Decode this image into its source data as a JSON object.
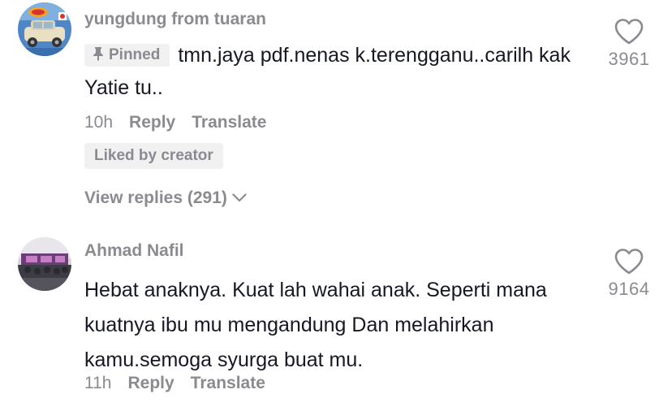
{
  "comments": [
    {
      "username": "yungdung from tuaran",
      "pinned_label": "Pinned",
      "text": "tmn.jaya pdf.nenas k.terengganu..carilh kak Yatie tu..",
      "time": "10h",
      "reply_label": "Reply",
      "translate_label": "Translate",
      "liked_by_creator_label": "Liked by creator",
      "view_replies_label": "View replies (291)",
      "like_count": "3961",
      "avatar_icon": "toy-car-avatar",
      "heart_icon": "heart-outline-icon"
    },
    {
      "username": "Ahmad Nafil",
      "text": "Hebat anaknya. Kuat lah wahai anak. Seperti mana kuatnya ibu mu mengandung Dan melahirkan kamu.semoga syurga buat mu.",
      "time": "11h",
      "reply_label": "Reply",
      "translate_label": "Translate",
      "like_count": "9164",
      "avatar_icon": "event-hall-avatar",
      "heart_icon": "heart-outline-icon"
    }
  ],
  "colors": {
    "primary_text": "#161823",
    "secondary_text": "#8a8b91",
    "badge_background": "#f1f1f2",
    "icon_stroke": "#8a8b91"
  }
}
